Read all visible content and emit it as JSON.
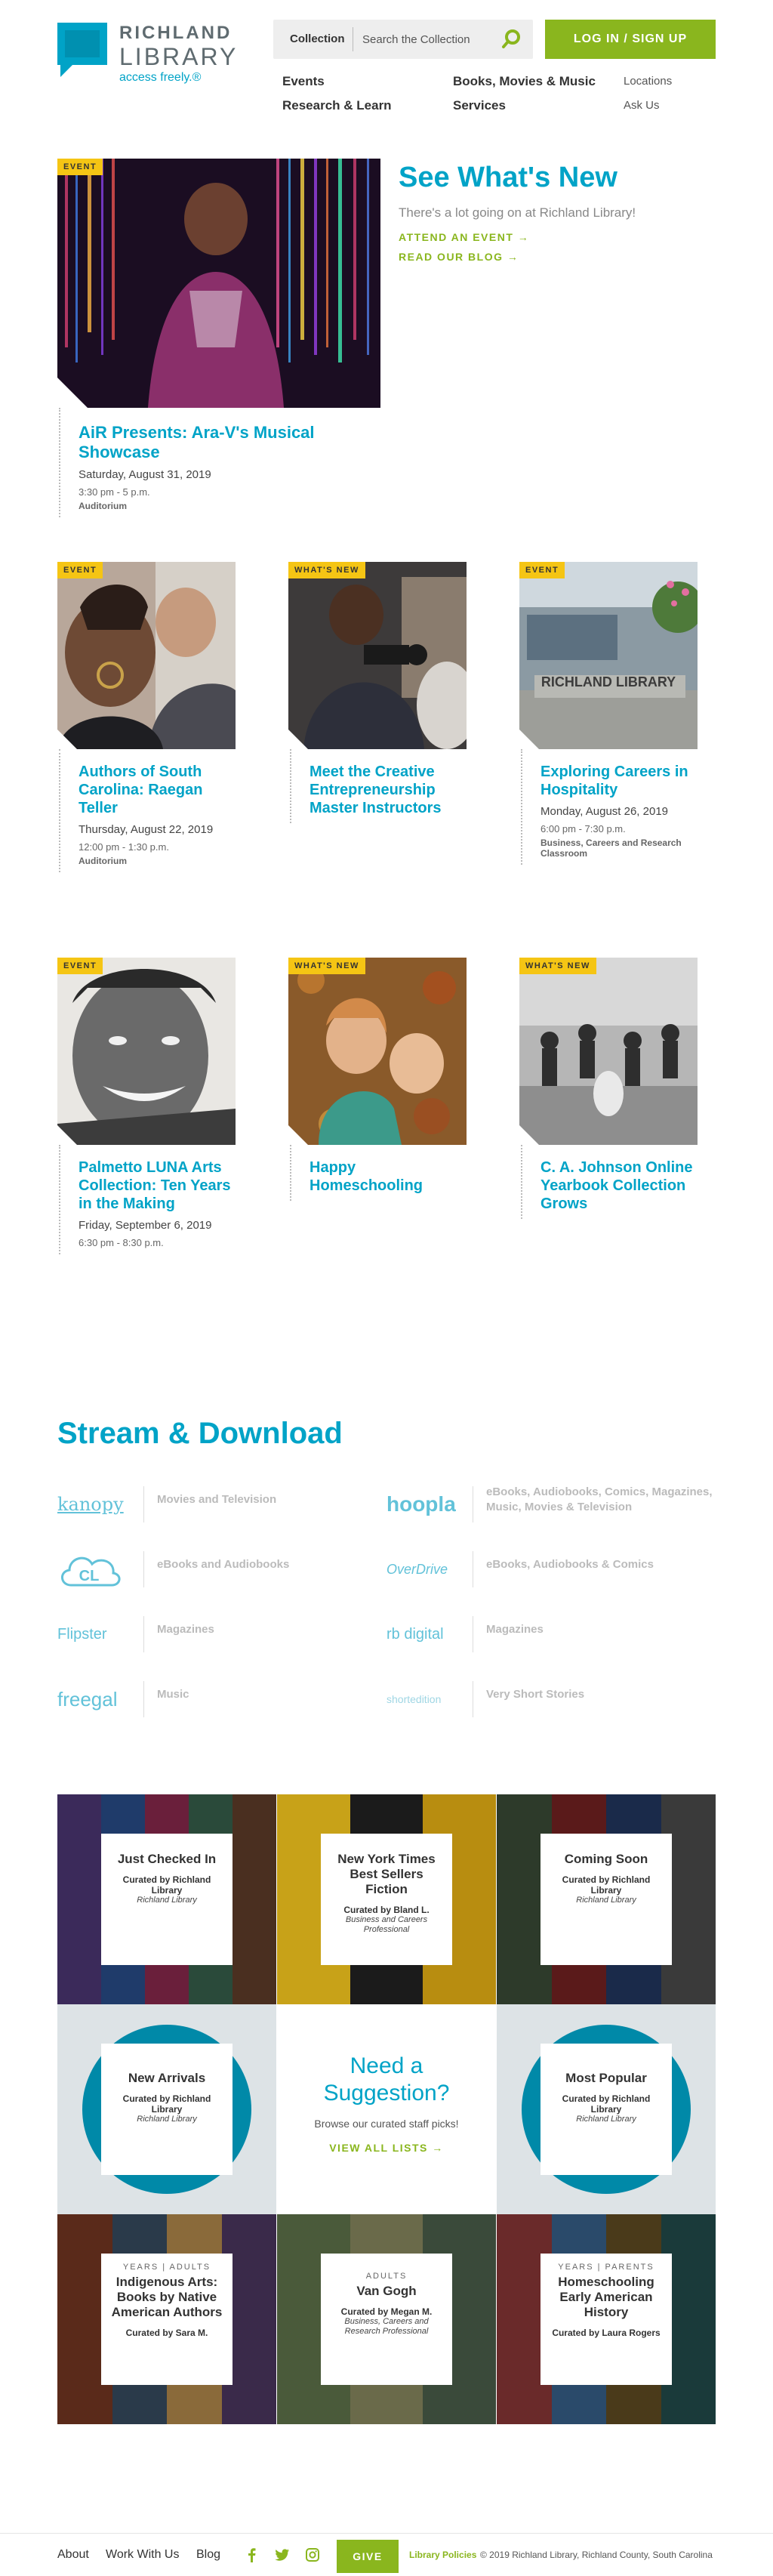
{
  "brand": {
    "name_line1": "RICHLAND",
    "name_line2": "LIBRARY",
    "tagline": "access freely.®",
    "accent": "#00a3c7",
    "green": "#8ab61e",
    "badge_yellow": "#f5c514"
  },
  "header": {
    "search_category": "Collection",
    "search_placeholder": "Search the Collection",
    "search_icon": "search-icon",
    "login_label": "LOG IN / SIGN UP",
    "nav_primary": [
      "Events",
      "Books, Movies & Music",
      "Research & Learn",
      "Services"
    ],
    "nav_secondary": [
      "Locations",
      "Ask Us"
    ]
  },
  "featured": {
    "badge": "EVENT",
    "heading": "See What's New",
    "subheading": "There's a lot going on at Richland Library!",
    "link_events": "ATTEND AN EVENT →",
    "link_blog": "READ OUR BLOG →",
    "title": "AiR Presents: Ara-V's Musical Showcase",
    "date": "Saturday, August 31, 2019",
    "time": "3:30 pm - 5 p.m.",
    "location": "Auditorium"
  },
  "cards": [
    {
      "badge": "EVENT",
      "title": "Authors of South Carolina: Raegan Teller",
      "date": "Thursday, August 22, 2019",
      "time": "12:00 pm - 1:30 p.m.",
      "location": "Auditorium"
    },
    {
      "badge": "WHAT'S NEW",
      "title": "Meet the Creative Entrepreneurship Master Instructors",
      "date": "",
      "time": "",
      "location": ""
    },
    {
      "badge": "EVENT",
      "title": "Exploring Careers in Hospitality",
      "date": "Monday, August 26, 2019",
      "time": "6:00 pm - 7:30 p.m.",
      "location": "Business, Careers and Research Classroom"
    },
    {
      "badge": "EVENT",
      "title": "Palmetto LUNA Arts Collection: Ten Years in the Making",
      "date": "Friday, September 6, 2019",
      "time": "6:30 pm - 8:30 p.m.",
      "location": ""
    },
    {
      "badge": "WHAT'S NEW",
      "title": "Happy Homeschooling",
      "date": "",
      "time": "",
      "location": ""
    },
    {
      "badge": "WHAT'S NEW",
      "title": "C. A. Johnson Online Yearbook Collection Grows",
      "date": "",
      "time": "",
      "location": ""
    }
  ],
  "stream": {
    "heading": "Stream & Download",
    "items": [
      {
        "logo": "kanopy",
        "label": "Movies and Television"
      },
      {
        "logo": "hoopla",
        "label": "eBooks, Audiobooks, Comics, Magazines, Music, Movies & Television"
      },
      {
        "logo": "CL",
        "label": "eBooks and Audiobooks"
      },
      {
        "logo": "OverDrive",
        "label": "eBooks, Audiobooks & Comics"
      },
      {
        "logo": "Flipster",
        "label": "Magazines"
      },
      {
        "logo": "rb digital",
        "label": "Magazines"
      },
      {
        "logo": "freegal",
        "label": "Music"
      },
      {
        "logo": "shortedition",
        "label": "Very Short Stories"
      }
    ]
  },
  "lists": {
    "tiles": [
      {
        "title": "Just Checked In",
        "curator": "Curated by Richland Library",
        "org": "Richland Library"
      },
      {
        "title": "New York Times Best Sellers Fiction",
        "curator": "Curated by Bland L.",
        "org": "Business and Careers Professional"
      },
      {
        "title": "Coming Soon",
        "curator": "Curated by Richland Library",
        "org": "Richland Library"
      },
      {
        "title": "New Arrivals",
        "curator": "Curated by Richland Library",
        "org": "Richland Library"
      },
      {
        "title": "Most Popular",
        "curator": "Curated by Richland Library",
        "org": "Richland Library"
      },
      {
        "audience": "YEARS | ADULTS",
        "title": "Indigenous Arts: Books by Native American Authors",
        "curator": "Curated by Sara M.",
        "org": ""
      },
      {
        "audience": "ADULTS",
        "title": "Van Gogh",
        "curator": "Curated by Megan M.",
        "org": "Business, Careers and Research Professional"
      },
      {
        "audience": "YEARS | PARENTS",
        "title": "Homeschooling Early American History",
        "curator": "Curated by Laura Rogers",
        "org": ""
      }
    ],
    "suggestion_heading": "Need a Suggestion?",
    "suggestion_sub": "Browse our curated staff picks!",
    "suggestion_link": "VIEW ALL LISTS →"
  },
  "footer": {
    "links": [
      "About",
      "Work With Us",
      "Blog"
    ],
    "social_icons": [
      "facebook-icon",
      "twitter-icon",
      "instagram-icon"
    ],
    "give_label": "GIVE",
    "policies": "Library Policies",
    "copyright": "© 2019 Richland Library, Richland County, South Carolina"
  }
}
